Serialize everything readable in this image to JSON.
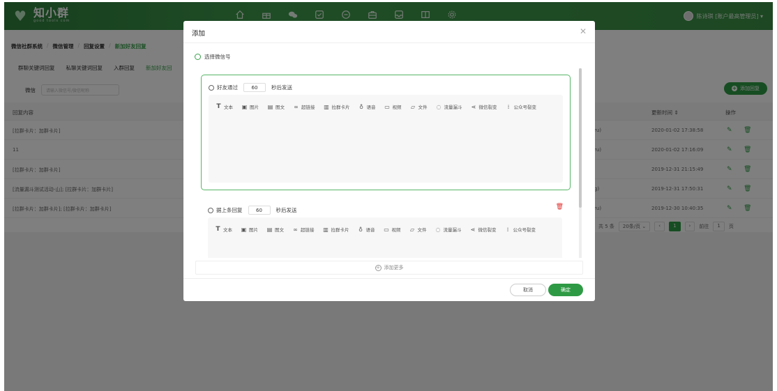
{
  "app": {
    "logo_title": "知小群",
    "logo_sub": "good tools com",
    "user_label": "陈诗琪 [账户最高管理员] ▾"
  },
  "nav": [
    "home-icon",
    "gift-icon",
    "wechat-icon",
    "check-square-icon",
    "chat-icon",
    "briefcase-icon",
    "inbox-icon",
    "book-icon",
    "settings-icon"
  ],
  "breadcrumb": [
    "微信社群系统",
    "微信管理",
    "回复设置",
    "新加好友回复"
  ],
  "subtabs": [
    "群聊关键词回复",
    "私聊关键词回复",
    "入群回复",
    "新加好友回"
  ],
  "filter": {
    "label": "微信",
    "placeholder": "请输入微信号/微信昵称"
  },
  "add_button": "添加回复",
  "table": {
    "headers": {
      "content": "回复内容",
      "updated": "更新时间 ⇕",
      "actions": "操作"
    },
    "rows": [
      {
        "content": "[拉群卡片：加群卡片]",
        "mid": "ru)",
        "time": "2020-01-02 17:38:58"
      },
      {
        "content": "11",
        "mid": "ru)",
        "time": "2020-01-02 17:16:09"
      },
      {
        "content": "[拉群卡片：加群卡片]",
        "mid": "",
        "time": "2019-12-31 21:15:49"
      },
      {
        "content": "[流量漏斗测试活动-山]; [拉群卡片：加群卡片]",
        "mid": "g)",
        "time": "2019-12-31 17:50:31"
      },
      {
        "content": "[拉群卡片：加群卡片]; [拉群卡片：加群卡片]",
        "mid": "ru)",
        "time": "2019-12-30 10:40:35"
      }
    ]
  },
  "pager": {
    "total": "共 5 条",
    "size": "20条/页 ⌄",
    "page": "1",
    "goto": "前往",
    "goto_val": "1",
    "unit": "页"
  },
  "modal": {
    "title": "添加",
    "select_wx": "选择微信号",
    "block1": {
      "prefix": "好友通过",
      "value": "60",
      "suffix": "秒后发送"
    },
    "block2": {
      "prefix": "据上条回复",
      "value": "60",
      "suffix": "秒后发送"
    },
    "tools": [
      {
        "icon": "T",
        "name": "text-tool",
        "label": "文本",
        "bold": true
      },
      {
        "icon": "▣",
        "name": "image-tool",
        "label": "图片"
      },
      {
        "icon": "▤",
        "name": "article-tool",
        "label": "图文"
      },
      {
        "icon": "∞",
        "name": "link-tool",
        "label": "超链接"
      },
      {
        "icon": "▥",
        "name": "group-card-tool",
        "label": "拉群卡片"
      },
      {
        "icon": "♁",
        "name": "voice-tool",
        "label": "语音"
      },
      {
        "icon": "▭",
        "name": "video-tool",
        "label": "视频"
      },
      {
        "icon": "▱",
        "name": "file-tool",
        "label": "文件"
      },
      {
        "icon": "◌",
        "name": "funnel-tool",
        "label": "流量漏斗"
      },
      {
        "icon": "⋖",
        "name": "fission-tool",
        "label": "微信裂变"
      },
      {
        "icon": "⁞",
        "name": "official-fission-tool",
        "label": "公众号裂变"
      }
    ],
    "add_more": "添加更多",
    "cancel": "取消",
    "ok": "确定"
  }
}
